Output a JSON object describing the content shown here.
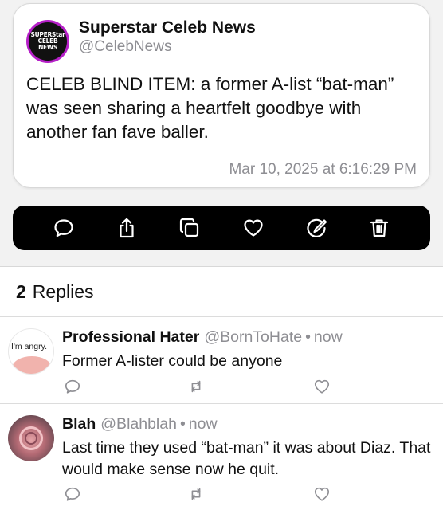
{
  "post": {
    "author_name": "Superstar Celeb News",
    "author_handle": "@CelebNews",
    "avatar_text": [
      "SUPERStar",
      "CELEB",
      "NEWS"
    ],
    "body": "CELEB BLIND ITEM: a former A-list “bat-man” was seen sharing a heartfelt goodbye with another fan fave baller.",
    "timestamp": "Mar 10, 2025 at 6:16:29 PM"
  },
  "toolbar": {
    "icons": [
      "reply-icon",
      "share-icon",
      "copy-icon",
      "heart-icon",
      "edit-icon",
      "trash-icon"
    ]
  },
  "replies_header": {
    "count": "2",
    "label": "Replies"
  },
  "replies": [
    {
      "name": "Professional Hater",
      "handle": "@BornToHate",
      "time": "now",
      "text": "Former A-lister could be anyone",
      "avatar_caption": "I'm angry."
    },
    {
      "name": "Blah",
      "handle": "@Blahblah",
      "time": "now",
      "text": "Last time they used “bat-man” it was about Diaz. That would make sense now he quit."
    }
  ],
  "colors": {
    "avatar_ring": "#b620c8",
    "secondary_text": "#8e8e93",
    "toolbar_bg": "#000000"
  }
}
